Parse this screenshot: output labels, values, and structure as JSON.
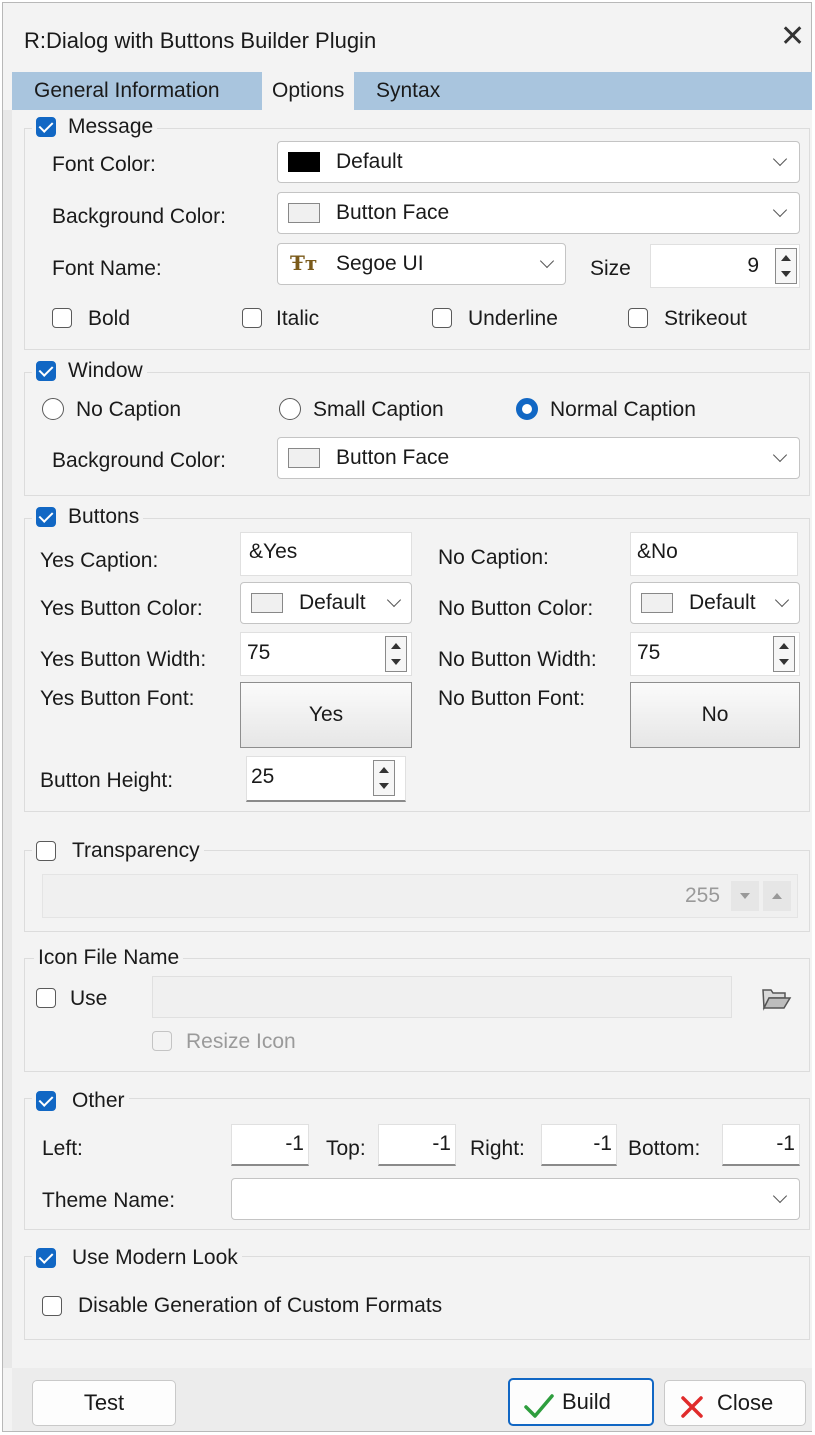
{
  "window": {
    "title": "R:Dialog with Buttons Builder Plugin"
  },
  "tabs": [
    "General Information",
    "Options",
    "Syntax"
  ],
  "message": {
    "title": "Message",
    "font_color_label": "Font Color:",
    "font_color_value": "Default",
    "bg_color_label": "Background Color:",
    "bg_color_value": "Button Face",
    "font_name_label": "Font Name:",
    "font_name_value": "Segoe UI",
    "size_label": "Size",
    "size_value": "9",
    "bold": "Bold",
    "italic": "Italic",
    "underline": "Underline",
    "strikeout": "Strikeout"
  },
  "window_group": {
    "title": "Window",
    "no_caption": "No Caption",
    "small_caption": "Small Caption",
    "normal_caption": "Normal Caption",
    "bg_color_label": "Background Color:",
    "bg_color_value": "Button Face"
  },
  "buttons": {
    "title": "Buttons",
    "yes_caption_label": "Yes Caption:",
    "yes_caption_value": "&Yes",
    "no_caption_label": "No Caption:",
    "no_caption_value": "&No",
    "yes_color_label": "Yes Button Color:",
    "yes_color_value": "Default",
    "no_color_label": "No Button Color:",
    "no_color_value": "Default",
    "yes_width_label": "Yes Button Width:",
    "yes_width_value": "75",
    "no_width_label": "No Button Width:",
    "no_width_value": "75",
    "yes_font_label": "Yes Button  Font:",
    "yes_font_button": "Yes",
    "no_font_label": "No Button  Font:",
    "no_font_button": "No",
    "height_label": "Button Height:",
    "height_value": "25"
  },
  "transparency": {
    "title": "Transparency",
    "value": "255"
  },
  "icon": {
    "title": "Icon File Name",
    "use": "Use",
    "resize": "Resize Icon"
  },
  "other": {
    "title": "Other",
    "left_label": "Left:",
    "left_value": "-1",
    "top_label": "Top:",
    "top_value": "-1",
    "right_label": "Right:",
    "right_value": "-1",
    "bottom_label": "Bottom:",
    "bottom_value": "-1",
    "theme_label": "Theme Name:"
  },
  "modern": {
    "title": "Use Modern Look",
    "disable_custom": "Disable Generation of Custom Formats"
  },
  "footer": {
    "test": "Test",
    "build": "Build",
    "close": "Close"
  },
  "colors": {
    "accent": "#1167c4",
    "tab_strip": "#a9c5de",
    "check_green": "#2e9e3e",
    "close_red": "#e02b2b"
  }
}
